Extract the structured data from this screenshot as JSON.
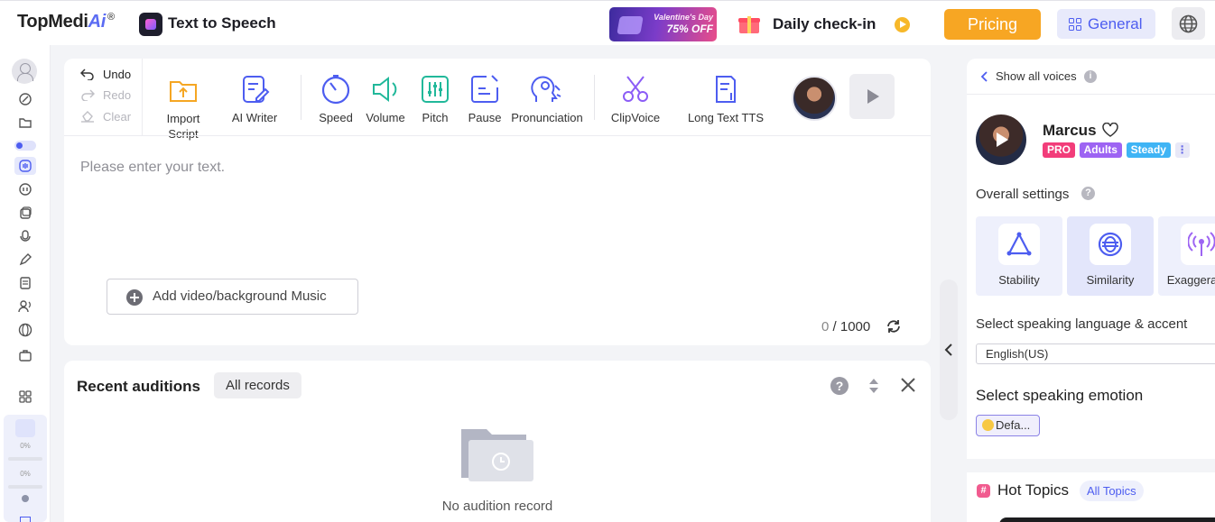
{
  "header": {
    "logo_text": "TopMedi",
    "logo_ai": "Ai",
    "logo_reg": "®",
    "app_title": "Text to Speech",
    "promo_line1": "Valentine's Day",
    "promo_line2": "75% OFF",
    "checkin_label": "Daily check-in",
    "pricing_label": "Pricing",
    "general_label": "General"
  },
  "rail": {
    "progress1": "0%",
    "progress2": "0%"
  },
  "editor": {
    "undo_label": "Undo",
    "redo_label": "Redo",
    "clear_label": "Clear",
    "tools": {
      "import_script": "Import Script",
      "ai_writer": "AI Writer",
      "speed": "Speed",
      "volume": "Volume",
      "pitch": "Pitch",
      "pause": "Pause",
      "pronunciation": "Pronunciation",
      "clipvoice": "ClipVoice",
      "long_text_tts": "Long Text TTS"
    },
    "placeholder": "Please enter your text.",
    "add_music_label": "Add video/background Music",
    "char_count": "0",
    "char_separator": " / ",
    "char_limit": "1000"
  },
  "auditions": {
    "title": "Recent auditions",
    "all_records_label": "All records",
    "empty_text": "No audition record"
  },
  "voice_panel": {
    "show_all_label": "Show all voices",
    "voice_name": "Marcus",
    "tags": [
      "PRO",
      "Adults",
      "Steady"
    ],
    "overall_settings_label": "Overall settings",
    "settings": [
      "Stability",
      "Similarity",
      "Exaggeration"
    ],
    "language_label": "Select speaking language & accent",
    "language_value": "English(US)",
    "emotion_label": "Select speaking emotion",
    "emotion_value": "Defa...",
    "hot_topics_label": "Hot Topics",
    "all_topics_label": "All Topics"
  },
  "colors": {
    "accent": "#4d5df0",
    "pricing": "#f7a623",
    "tag_pro": "#f23d7a",
    "tag_adults": "#9d64f3",
    "tag_steady": "#3fb4f5"
  }
}
